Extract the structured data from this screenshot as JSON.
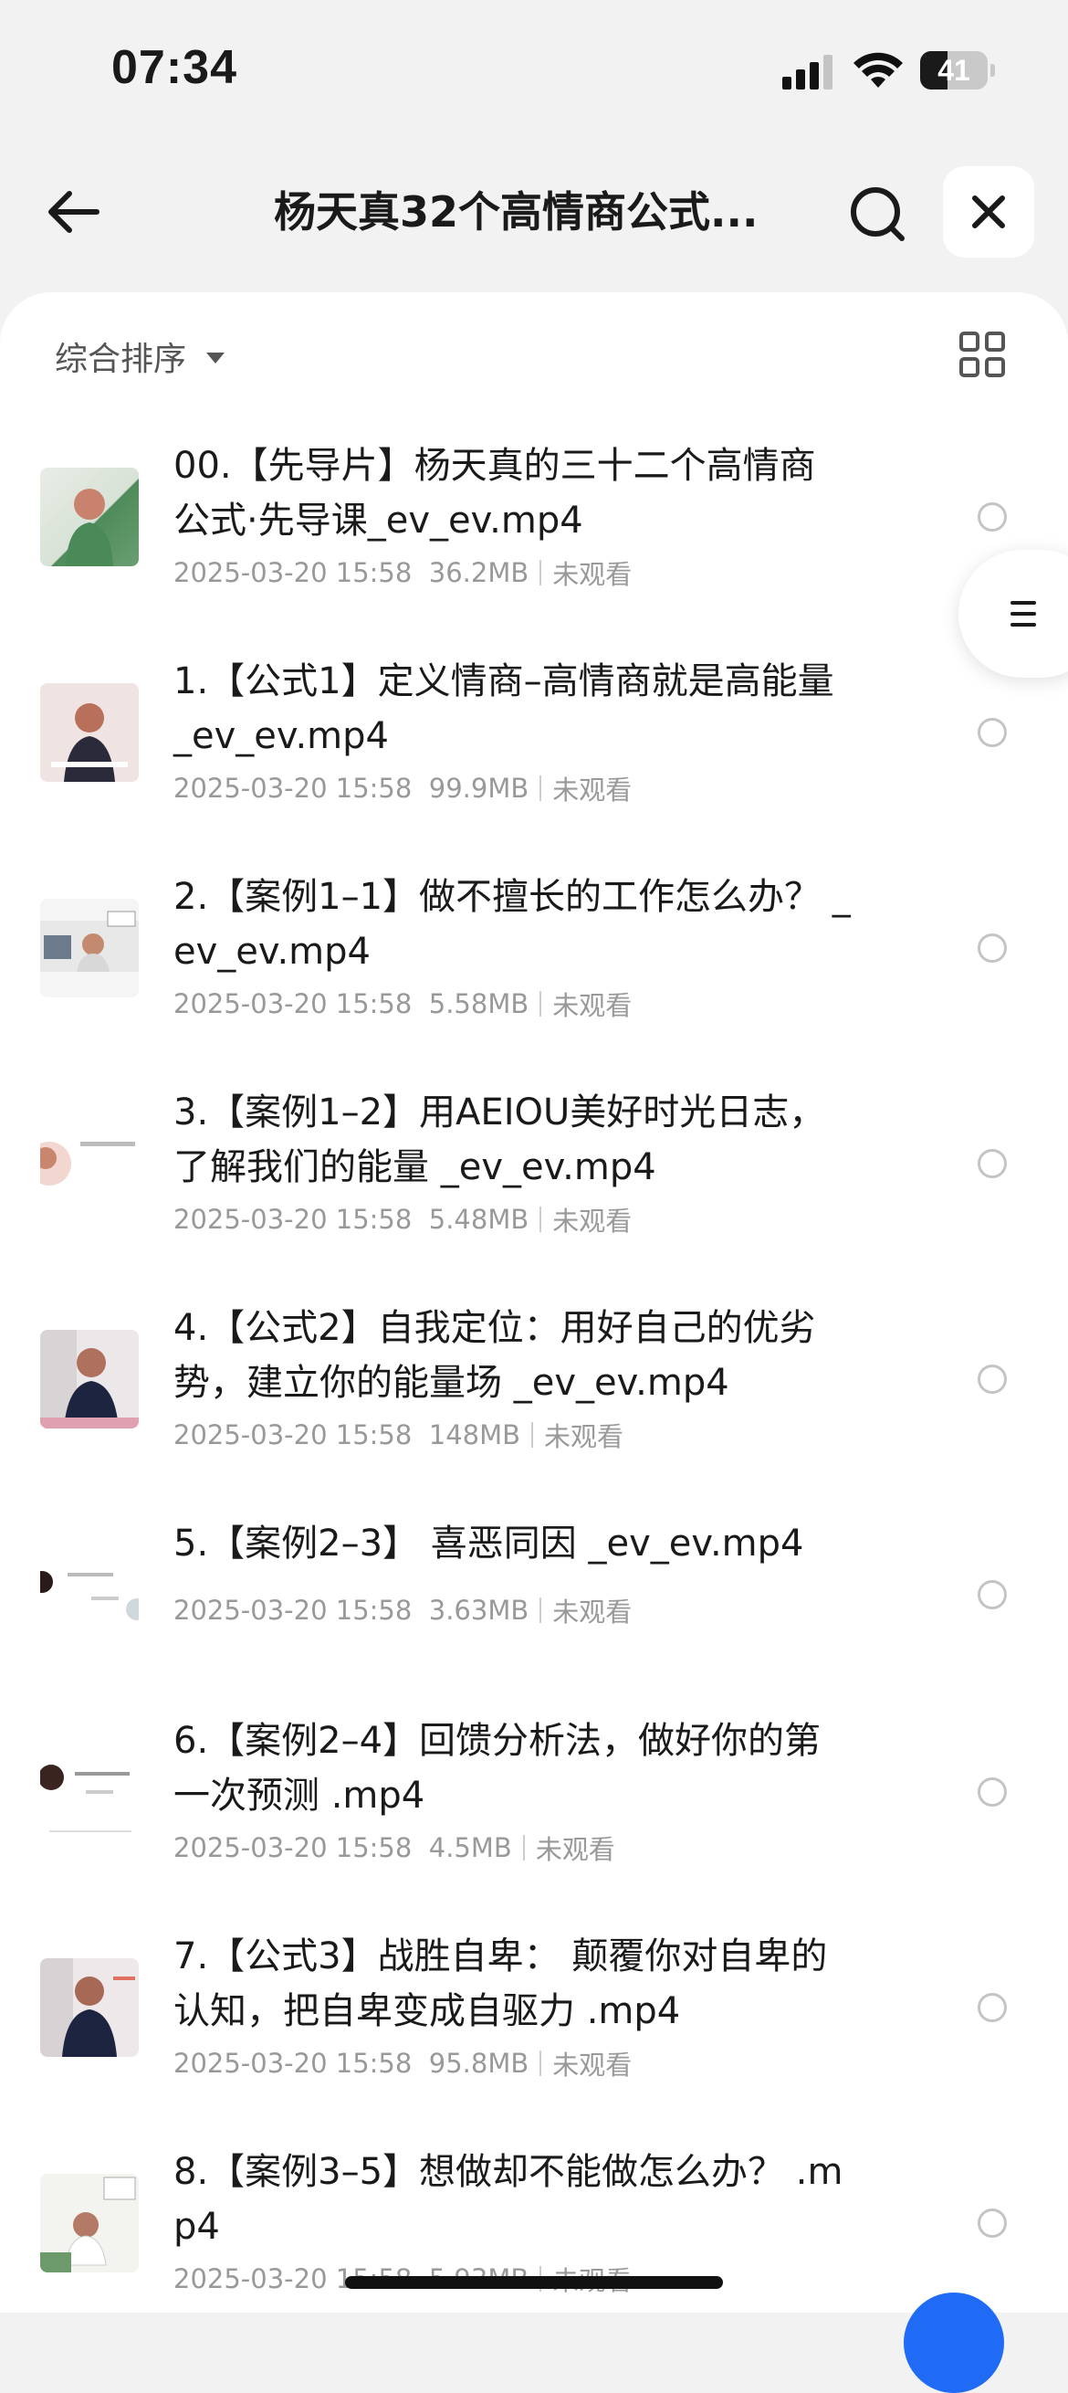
{
  "status_bar": {
    "time": "07:34",
    "battery_level": "41",
    "battery_fraction": 0.41
  },
  "header": {
    "title": "杨天真32个高情商公式...",
    "back_icon": "arrow-left-icon",
    "search_icon": "search-icon",
    "close_icon": "close-icon"
  },
  "sort_bar": {
    "sort_label": "综合排序",
    "view_toggle_icon": "grid-view-icon"
  },
  "files": [
    {
      "name_line1": "00.【先导片】杨天真的三十二个高情商",
      "name_line2": "公式·先导课_ev_ev.mp4",
      "date": "2025-03-20 15:58",
      "size": "36.2MB",
      "status": "未观看"
    },
    {
      "name_line1": "1.【公式1】定义情商–高情商就是高能量",
      "name_line2": "_ev_ev.mp4",
      "date": "2025-03-20 15:58",
      "size": "99.9MB",
      "status": "未观看"
    },
    {
      "name_line1": "2.【案例1–1】做不擅长的工作怎么办？ _",
      "name_line2": "ev_ev.mp4",
      "date": "2025-03-20 15:58",
      "size": "5.58MB",
      "status": "未观看"
    },
    {
      "name_line1": "3.【案例1–2】用AEIOU美好时光日志，",
      "name_line2": "了解我们的能量 _ev_ev.mp4",
      "date": "2025-03-20 15:58",
      "size": "5.48MB",
      "status": "未观看"
    },
    {
      "name_line1": "4.【公式2】自我定位：用好自己的优劣",
      "name_line2": "势，建立你的能量场 _ev_ev.mp4",
      "date": "2025-03-20 15:58",
      "size": "148MB",
      "status": "未观看"
    },
    {
      "name_line1": "5.【案例2–3】 喜恶同因 _ev_ev.mp4",
      "name_line2": "",
      "date": "2025-03-20 15:58",
      "size": "3.63MB",
      "status": "未观看"
    },
    {
      "name_line1": "6.【案例2–4】回馈分析法，做好你的第",
      "name_line2": "一次预测 .mp4",
      "date": "2025-03-20 15:58",
      "size": "4.5MB",
      "status": "未观看"
    },
    {
      "name_line1": "7.【公式3】战胜自卑： 颠覆你对自卑的",
      "name_line2": "认知，把自卑变成自驱力 .mp4",
      "date": "2025-03-20 15:58",
      "size": "95.8MB",
      "status": "未观看"
    },
    {
      "name_line1": "8.【案例3–5】想做却不能做怎么办？ .m",
      "name_line2": "p4",
      "date": "2025-03-20 15:58",
      "size": "5.93MB",
      "status": "未观看"
    }
  ],
  "float_menu": {
    "icon": "menu-lines-icon"
  },
  "colors": {
    "background": "#f2f2f2",
    "panel": "#ffffff",
    "primary_text": "#1a1a1a",
    "secondary_text": "#999999",
    "accent": "#1f6bf5"
  }
}
